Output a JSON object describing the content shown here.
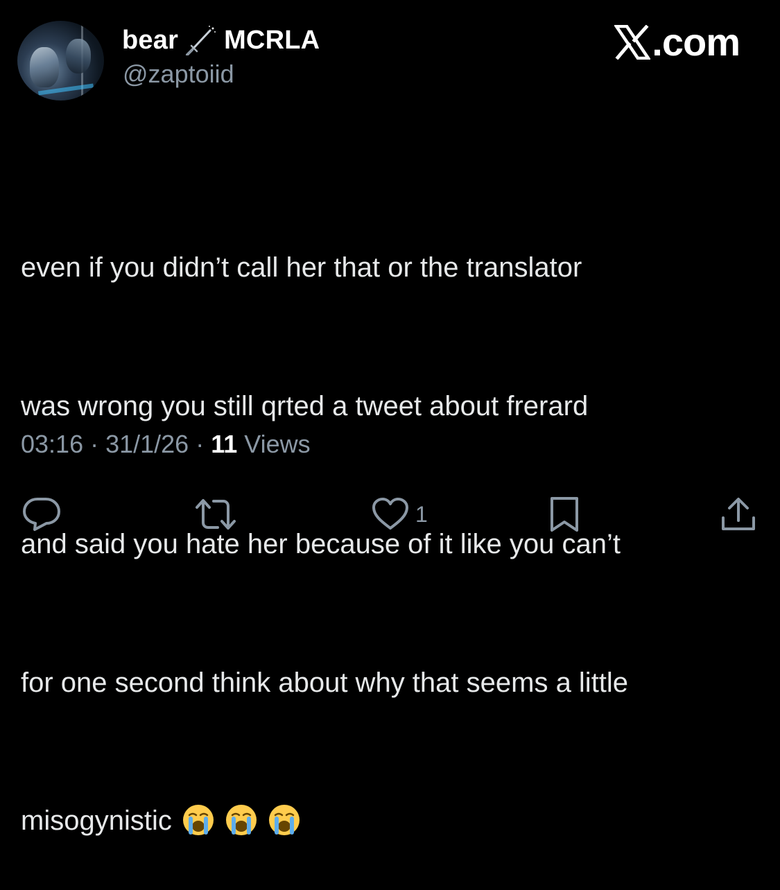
{
  "user": {
    "display_name": "bear",
    "name_suffix": "MCRLA",
    "handle": "@zaptoiid",
    "avatar_icon": "avatar-photo"
  },
  "brand": {
    "label": ".com",
    "icon": "x-logo-icon"
  },
  "tweet": {
    "lines": [
      "even if you didn’t call her that or the translator",
      "was wrong you still qrted a tweet about frerard",
      "and said you hate her because of it like you can’t",
      "for one second think about why that seems a little",
      "misogynistic"
    ],
    "emojis": [
      "loudly-crying-face",
      "loudly-crying-face",
      "loudly-crying-face"
    ]
  },
  "meta": {
    "time": "03:16",
    "date": "31/1/26",
    "separator": "·",
    "views_count": "11",
    "views_label": "Views"
  },
  "actions": {
    "reply_icon": "reply-icon",
    "retweet_icon": "retweet-icon",
    "like_icon": "heart-icon",
    "like_count": "1",
    "bookmark_icon": "bookmark-icon",
    "share_icon": "share-icon"
  },
  "colors": {
    "background": "#000000",
    "text": "#e7e9ea",
    "muted": "#8b98a5",
    "emoji_face": "#ffcc4d",
    "emoji_tears": "#5dadec"
  }
}
